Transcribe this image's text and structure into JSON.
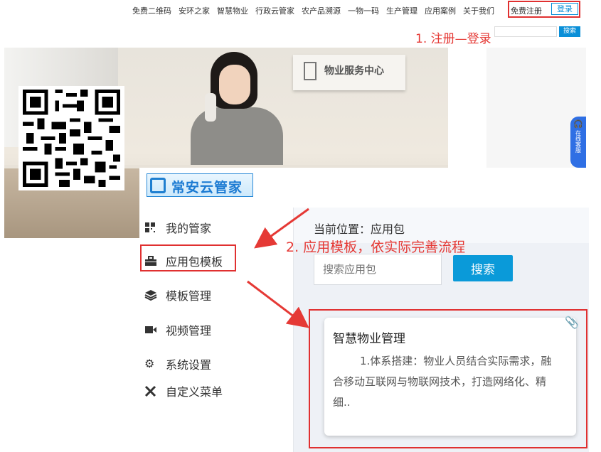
{
  "topnav": {
    "items": [
      "免费二维码",
      "安环之家",
      "智慧物业",
      "行政云管家",
      "农产品溯源",
      "一物一码",
      "生产管理",
      "应用案例",
      "关于我们"
    ],
    "register": "免费注册",
    "login": "登录",
    "search_button": "搜索"
  },
  "annotations": {
    "step1": "1. 注册—登录",
    "step2": "2. 应用模板，依实际完善流程"
  },
  "banner": {
    "sign_text": "物业服务中心",
    "float_service": "在线客服"
  },
  "app": {
    "logo_text": "常安云管家",
    "sidebar": [
      {
        "label": "我的管家",
        "icon": "grid-icon"
      },
      {
        "label": "应用包模板",
        "icon": "toolbox-icon"
      },
      {
        "label": "模板管理",
        "icon": "layers-icon"
      },
      {
        "label": "视频管理",
        "icon": "video-camera-icon"
      },
      {
        "label": "系统设置",
        "icon": "gear-icon"
      },
      {
        "label": "自定义菜单",
        "icon": "tools-icon"
      }
    ],
    "breadcrumb": "当前位置：应用包",
    "search": {
      "placeholder": "搜索应用包",
      "button": "搜索"
    },
    "card": {
      "title": "智慧物业管理",
      "description": "1.体系搭建：物业人员结合实际需求，融合移动互联网与物联网技术，打造网络化、精细.."
    }
  },
  "colors": {
    "accent": "#0a9ad9",
    "annotation": "#e53935",
    "logo_blue": "#1b7ad2"
  }
}
